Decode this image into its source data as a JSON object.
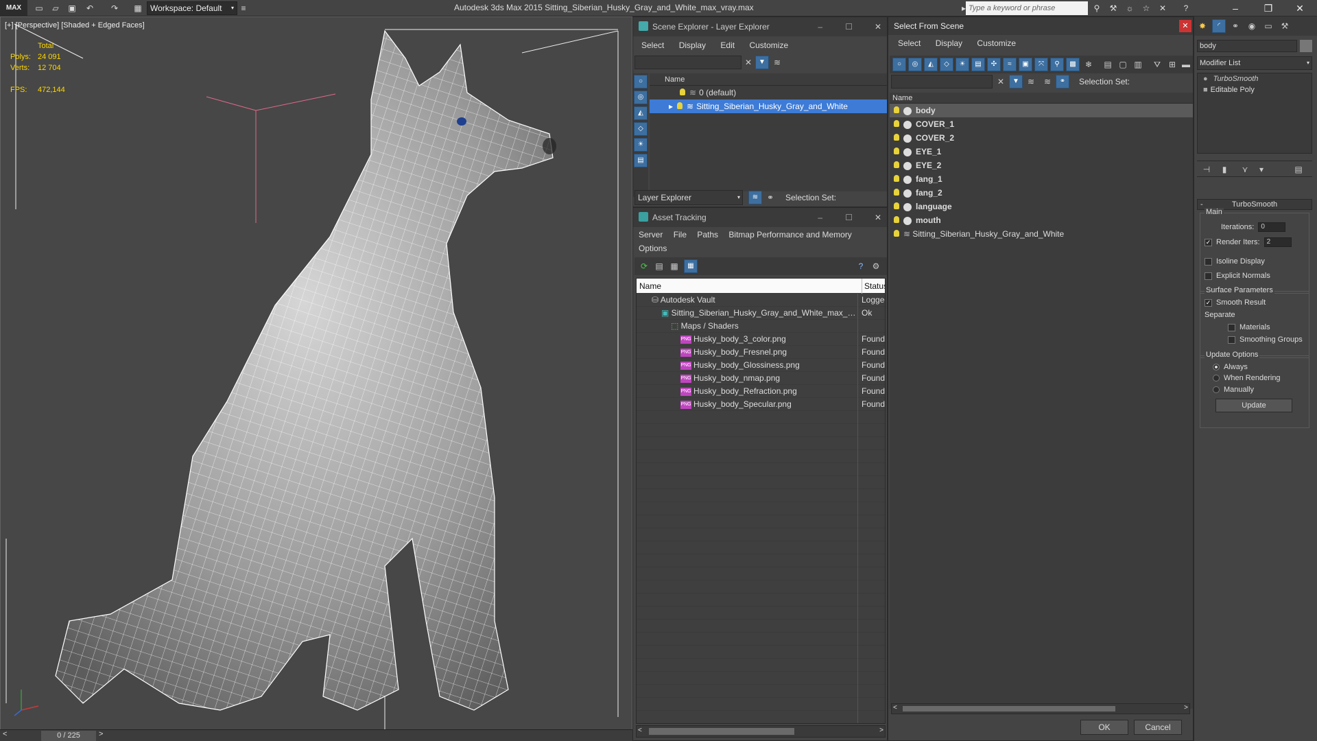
{
  "app": {
    "logo": "MAX",
    "workspace": "Workspace: Default",
    "title": "Autodesk 3ds Max  2015     Sitting_Siberian_Husky_Gray_and_White_max_vray.max",
    "search_placeholder": "Type a keyword or phrase"
  },
  "viewport": {
    "label": "[+] [Perspective] [Shaded + Edged Faces]",
    "stats": {
      "total_label": "Total",
      "polys_label": "Polys:",
      "polys": "24 091",
      "verts_label": "Verts:",
      "verts": "12 704",
      "fps_label": "FPS:",
      "fps": "472,144"
    },
    "frame": "0 / 225"
  },
  "scene_explorer": {
    "title": "Scene Explorer - Layer Explorer",
    "menu": [
      "Select",
      "Display",
      "Edit",
      "Customize"
    ],
    "column_name": "Name",
    "layers": [
      "0 (default)",
      "Sitting_Siberian_Husky_Gray_and_White"
    ],
    "footer_dropdown": "Layer Explorer",
    "selection_set": "Selection Set:"
  },
  "asset_tracking": {
    "title": "Asset Tracking",
    "menu": [
      "Server",
      "File",
      "Paths",
      "Bitmap Performance and Memory"
    ],
    "menu2": "Options",
    "col_name": "Name",
    "col_status": "Status",
    "rows": [
      {
        "name": "Autodesk Vault",
        "status": "Logged"
      },
      {
        "name": "Sitting_Siberian_Husky_Gray_and_White_max_vr...",
        "status": "Ok"
      },
      {
        "name": "Maps / Shaders",
        "status": ""
      },
      {
        "name": "Husky_body_3_color.png",
        "status": "Found"
      },
      {
        "name": "Husky_body_Fresnel.png",
        "status": "Found"
      },
      {
        "name": "Husky_body_Glossiness.png",
        "status": "Found"
      },
      {
        "name": "Husky_body_nmap.png",
        "status": "Found"
      },
      {
        "name": "Husky_body_Refraction.png",
        "status": "Found"
      },
      {
        "name": "Husky_body_Specular.png",
        "status": "Found"
      }
    ]
  },
  "select_from_scene": {
    "title": "Select From Scene",
    "menu": [
      "Select",
      "Display",
      "Customize"
    ],
    "selection_set": "Selection Set:",
    "column_name": "Name",
    "objects": [
      "body",
      "COVER_1",
      "COVER_2",
      "EYE_1",
      "EYE_2",
      "fang_1",
      "fang_2",
      "language",
      "mouth",
      "Sitting_Siberian_Husky_Gray_and_White"
    ],
    "ok": "OK",
    "cancel": "Cancel"
  },
  "command_panel": {
    "object_name": "body",
    "modifier_list": "Modifier List",
    "stack": [
      "TurboSmooth",
      "Editable Poly"
    ],
    "rollout_title": "TurboSmooth",
    "main": "Main",
    "iterations_label": "Iterations:",
    "iterations": "0",
    "render_iters_label": "Render Iters:",
    "render_iters": "2",
    "isoline": "Isoline Display",
    "explicit_normals": "Explicit Normals",
    "surface_params": "Surface Parameters",
    "smooth_result": "Smooth Result",
    "separate": "Separate",
    "materials": "Materials",
    "smoothing_groups": "Smoothing Groups",
    "update_options": "Update Options",
    "always": "Always",
    "when_rendering": "When Rendering",
    "manually": "Manually",
    "update_button": "Update"
  },
  "colors": {
    "selection_blue": "#3d7bd6",
    "stats_yellow": "#ffd800",
    "png_magenta": "#c045c0"
  }
}
